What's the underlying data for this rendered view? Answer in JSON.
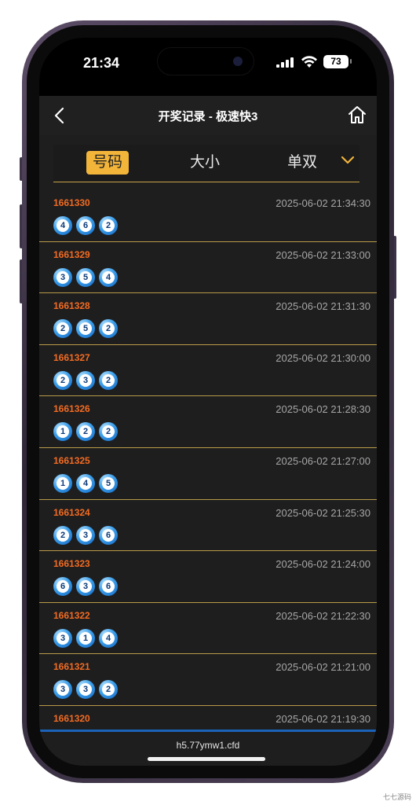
{
  "status": {
    "time": "21:34",
    "battery": "73"
  },
  "nav": {
    "title": "开奖记录 - 极速快3"
  },
  "tabs": [
    {
      "label": "号码",
      "active": true
    },
    {
      "label": "大小",
      "active": false
    },
    {
      "label": "单双",
      "active": false
    }
  ],
  "records": [
    {
      "issue": "1661330",
      "time": "2025-06-02 21:34:30",
      "balls": [
        "4",
        "6",
        "2"
      ]
    },
    {
      "issue": "1661329",
      "time": "2025-06-02 21:33:00",
      "balls": [
        "3",
        "5",
        "4"
      ]
    },
    {
      "issue": "1661328",
      "time": "2025-06-02 21:31:30",
      "balls": [
        "2",
        "5",
        "2"
      ]
    },
    {
      "issue": "1661327",
      "time": "2025-06-02 21:30:00",
      "balls": [
        "2",
        "3",
        "2"
      ]
    },
    {
      "issue": "1661326",
      "time": "2025-06-02 21:28:30",
      "balls": [
        "1",
        "2",
        "2"
      ]
    },
    {
      "issue": "1661325",
      "time": "2025-06-02 21:27:00",
      "balls": [
        "1",
        "4",
        "5"
      ]
    },
    {
      "issue": "1661324",
      "time": "2025-06-02 21:25:30",
      "balls": [
        "2",
        "3",
        "6"
      ]
    },
    {
      "issue": "1661323",
      "time": "2025-06-02 21:24:00",
      "balls": [
        "6",
        "3",
        "6"
      ]
    },
    {
      "issue": "1661322",
      "time": "2025-06-02 21:22:30",
      "balls": [
        "3",
        "1",
        "4"
      ]
    },
    {
      "issue": "1661321",
      "time": "2025-06-02 21:21:00",
      "balls": [
        "3",
        "3",
        "2"
      ]
    },
    {
      "issue": "1661320",
      "time": "2025-06-02 21:19:30",
      "balls": [
        "",
        "",
        ""
      ]
    }
  ],
  "bottom": {
    "url": "h5.77ymw1.cfd"
  },
  "watermark": "七七源码",
  "colors": {
    "accent": "#f3b43a",
    "issue": "#f26b21",
    "divider": "#c9a54a",
    "bottom_line": "#1a63b8"
  }
}
